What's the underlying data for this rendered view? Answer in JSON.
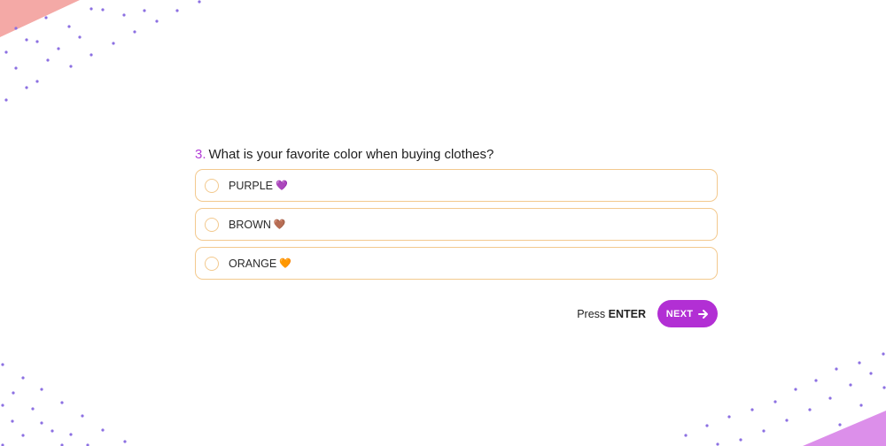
{
  "question": {
    "number": "3.",
    "text": "What is your favorite color when buying clothes?"
  },
  "options": [
    {
      "label": "PURPLE",
      "emoji": "💜",
      "emoji_color": "#9b3fe3"
    },
    {
      "label": "BROWN",
      "emoji": "🤎",
      "emoji_color": "#7a4a2a"
    },
    {
      "label": "ORANGE",
      "emoji": "🧡",
      "emoji_color": "#f28a1b"
    }
  ],
  "footer": {
    "press_label": "Press",
    "enter_label": "ENTER",
    "next_label": "NEXT"
  },
  "icons": {
    "next": "arrow-right-icon"
  },
  "colors": {
    "accent": "#b22fd4",
    "question_number": "#b23cd6",
    "option_border": "#f3c98e",
    "dots": "#8c6ee0",
    "corner_top_left": "#f2a3a3",
    "corner_bottom_right": "#d98ae8"
  }
}
